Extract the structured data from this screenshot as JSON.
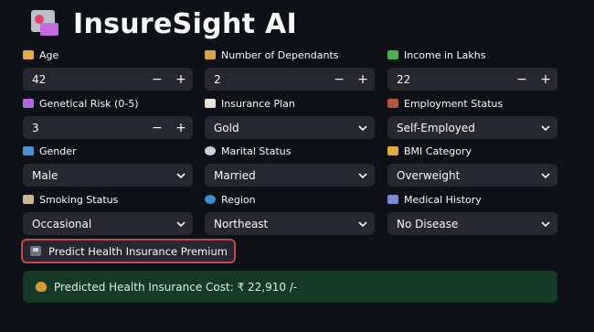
{
  "app": {
    "title": "InsureSight AI",
    "logo_icon": "insurance-card-icon"
  },
  "fields": {
    "age": {
      "label": "Age",
      "value": "42",
      "icon": "cake-icon",
      "icon_color": "#e7a94a"
    },
    "dependants": {
      "label": "Number of Dependants",
      "value": "2",
      "icon": "people-icon",
      "icon_color": "#d7a84a"
    },
    "income": {
      "label": "Income in Lakhs",
      "value": "22",
      "icon": "money-icon",
      "icon_color": "#4caf50"
    },
    "genetic_risk": {
      "label": "Genetical Risk (0-5)",
      "value": "3",
      "icon": "dna-icon",
      "icon_color": "#b56bd6"
    },
    "insurance_plan": {
      "label": "Insurance Plan",
      "value": "Gold",
      "icon": "document-icon",
      "icon_color": "#e9e4da"
    },
    "employment": {
      "label": "Employment Status",
      "value": "Self-Employed",
      "icon": "briefcase-icon",
      "icon_color": "#b0583f"
    },
    "gender": {
      "label": "Gender",
      "value": "Male",
      "icon": "gender-icon",
      "icon_color": "#4e8fd6"
    },
    "marital": {
      "label": "Marital Status",
      "value": "Married",
      "icon": "ring-icon",
      "icon_color": "#c9d3dd"
    },
    "bmi": {
      "label": "BMI Category",
      "value": "Overweight",
      "icon": "scale-icon",
      "icon_color": "#e0a93e"
    },
    "smoking": {
      "label": "Smoking Status",
      "value": "Occasional",
      "icon": "cigarette-icon",
      "icon_color": "#c9b896"
    },
    "region": {
      "label": "Region",
      "value": "Northeast",
      "icon": "globe-icon",
      "icon_color": "#3c8fd0"
    },
    "medical_history": {
      "label": "Medical History",
      "value": "No Disease",
      "icon": "stethoscope-icon",
      "icon_color": "#7d8bd6"
    }
  },
  "stepper": {
    "minus": "−",
    "plus": "+"
  },
  "predict": {
    "label": "Predict Health Insurance Premium",
    "icon": "calculator-icon",
    "border_color": "#c1484d"
  },
  "result": {
    "text": "Predicted Health Insurance Cost: ₹ 22,910 /-",
    "icon": "money-bag-icon",
    "bg_color": "#173928"
  }
}
